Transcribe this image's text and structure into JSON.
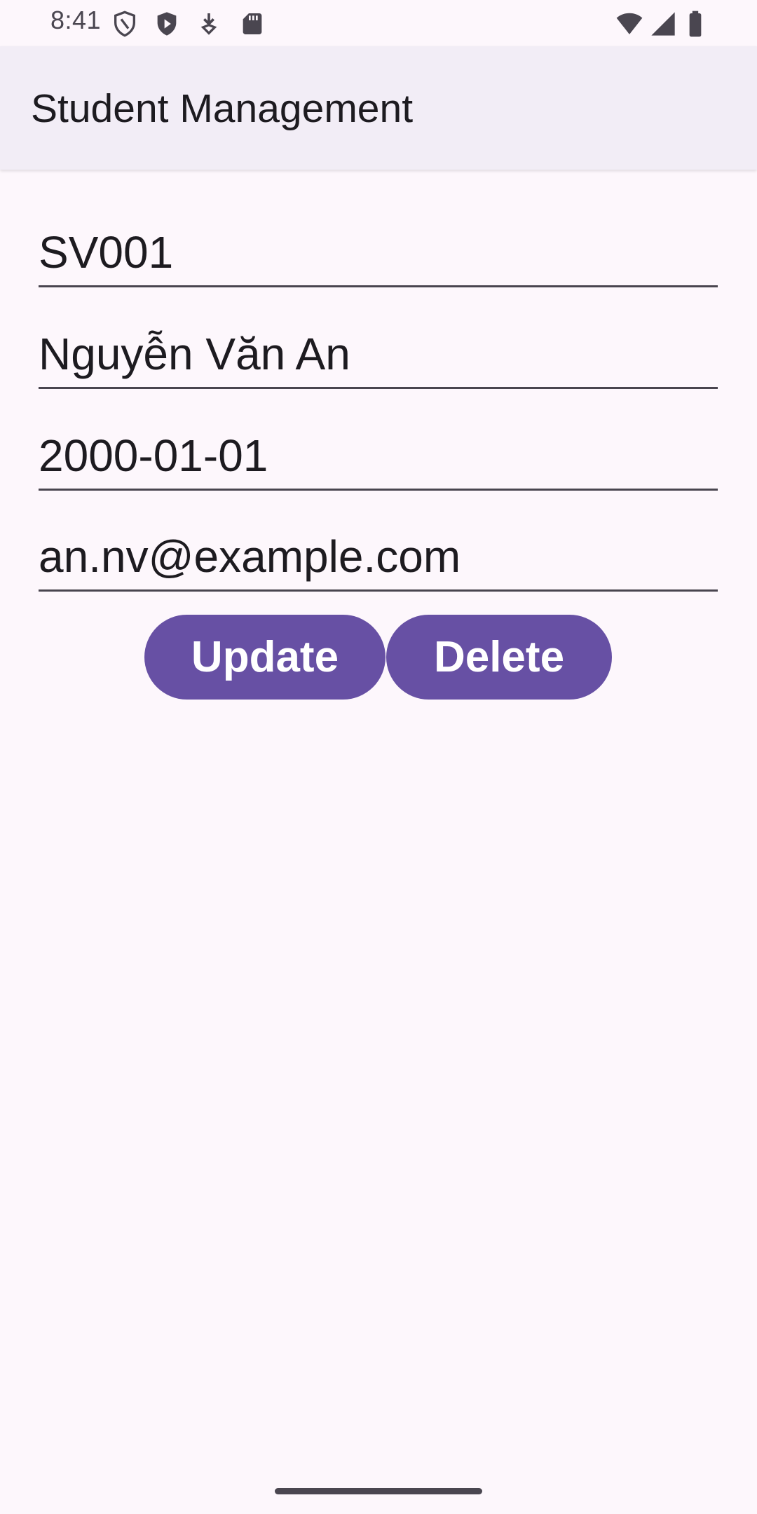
{
  "status_bar": {
    "time": "8:41",
    "left_icons": [
      "shield-outline-icon",
      "shield-play-icon",
      "download-icon",
      "sd-card-icon"
    ],
    "right_icons": [
      "wifi-icon",
      "cellular-signal-icon",
      "battery-icon"
    ]
  },
  "app_bar": {
    "title": "Student Management"
  },
  "form": {
    "student_id": "SV001",
    "name": "Nguyễn Văn An",
    "birth_date": "2000-01-01",
    "email": "an.nv@example.com"
  },
  "actions": {
    "update_label": "Update",
    "delete_label": "Delete"
  },
  "colors": {
    "background": "#FDF7FC",
    "app_bar": "#F2EDF6",
    "primary": "#6750A4",
    "on_primary": "#FFFFFF",
    "text": "#1D1B20",
    "underline": "#49454F"
  }
}
